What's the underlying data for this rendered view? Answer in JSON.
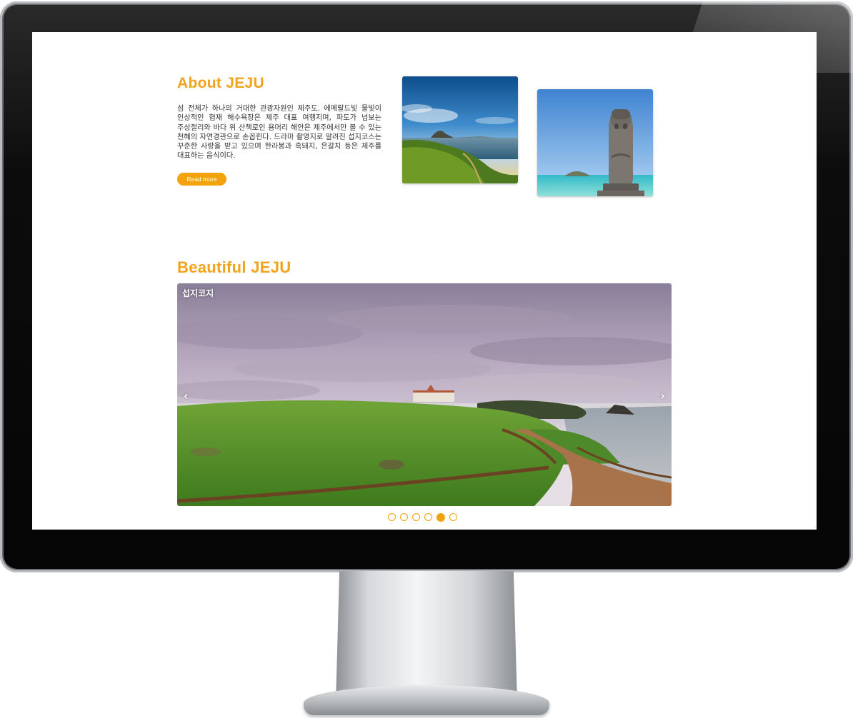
{
  "about": {
    "title": "About JEJU",
    "text": "섬 전체가 하나의 거대한 관광자원인 제주도. 에메랄드빛 물빛이 인상적인 협재 해수욕장은 제주 대표 여행지며, 파도가 넘보는 주상절리와 바다 위 산책로인 용머리 해안은 제주에서만 볼 수 있는 천혜의 자연경관으로 손꼽힌다. 드라마 촬영지로 알려진 섭지코스는 꾸준한 사랑을 받고 있으며 한라봉과 흑돼지, 은갈치 등은 제주를 대표하는 음식이다.",
    "read_more_label": "Read more"
  },
  "gallery": {
    "title": "Beautiful JEJU",
    "caption": "섭지코지",
    "prev_icon": "‹",
    "next_icon": "›",
    "slide_count": 6,
    "active_slide": 5
  },
  "colors": {
    "accent": "#f2a21b",
    "button": "#f4a20c",
    "text": "#333333"
  },
  "icons": [
    "chevron-left-icon",
    "chevron-right-icon"
  ]
}
